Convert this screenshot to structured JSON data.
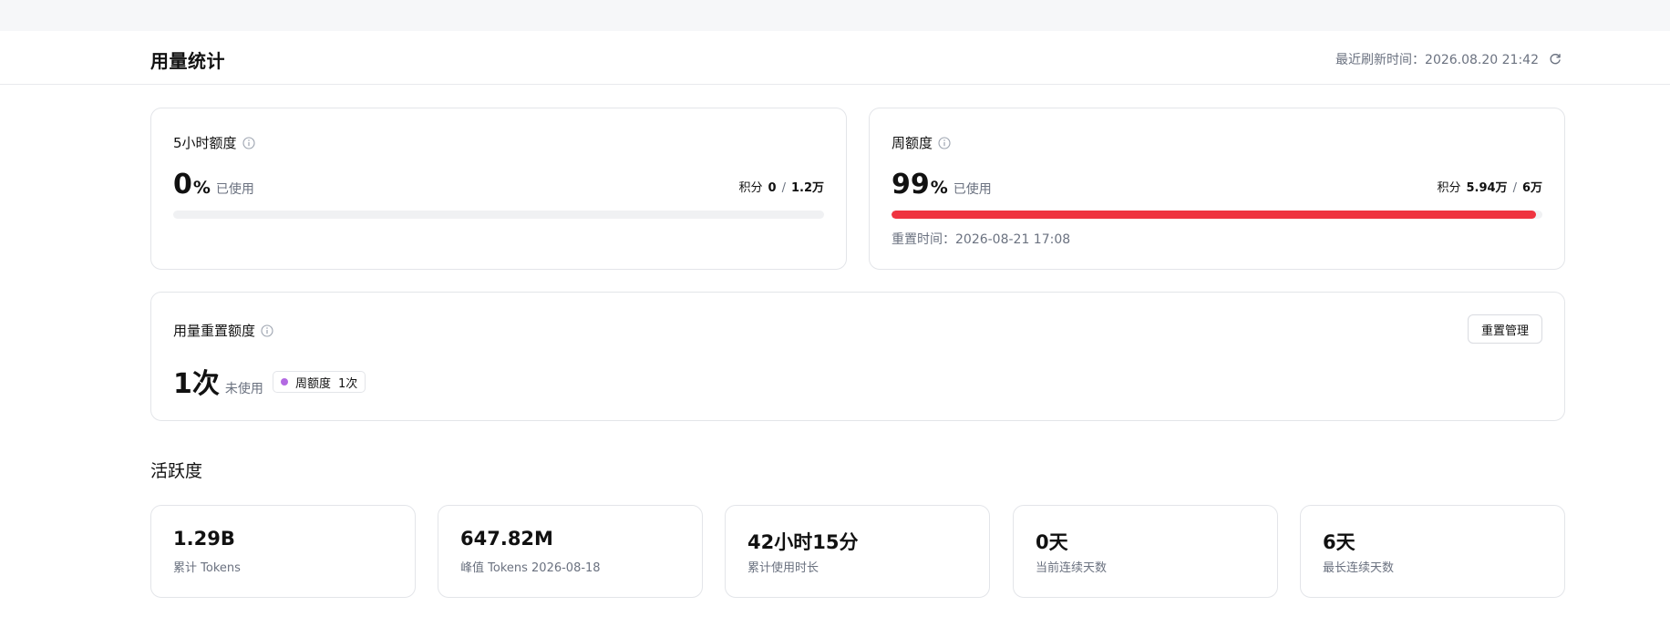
{
  "header": {
    "title": "用量统计",
    "refresh_text": "最近刷新时间：2026.08.20 21:42",
    "refresh_icon": "refresh-icon"
  },
  "quota_5h": {
    "title": "5小时额度",
    "percent": "0",
    "percent_unit": "%",
    "used_label": "已使用",
    "points_label": "积分",
    "points_used": "0",
    "points_total": "1.2万",
    "progress": 0
  },
  "quota_week": {
    "title": "周额度",
    "percent": "99",
    "percent_unit": "%",
    "used_label": "已使用",
    "points_label": "积分",
    "points_used": "5.94万",
    "points_total": "6万",
    "progress": 0.99,
    "bar_color": "#ef3340",
    "reset_time": "重置时间：2026-08-21 17:08"
  },
  "reset_quota": {
    "title": "用量重置额度",
    "count": "1次",
    "unused_label": "未使用",
    "manage_button": "重置管理",
    "tag_label": "周额度",
    "tag_count": "1次",
    "tag_color": "#b36ae2"
  },
  "activity": {
    "title": "活跃度",
    "stats": [
      {
        "value": "1.29B",
        "label": "累计 Tokens"
      },
      {
        "value": "647.82M",
        "label": "峰值 Tokens 2026-08-18"
      },
      {
        "value": "42小时15分",
        "label": "累计使用时长"
      },
      {
        "value": "0天",
        "label": "当前连续天数"
      },
      {
        "value": "6天",
        "label": "最长连续天数"
      }
    ]
  }
}
